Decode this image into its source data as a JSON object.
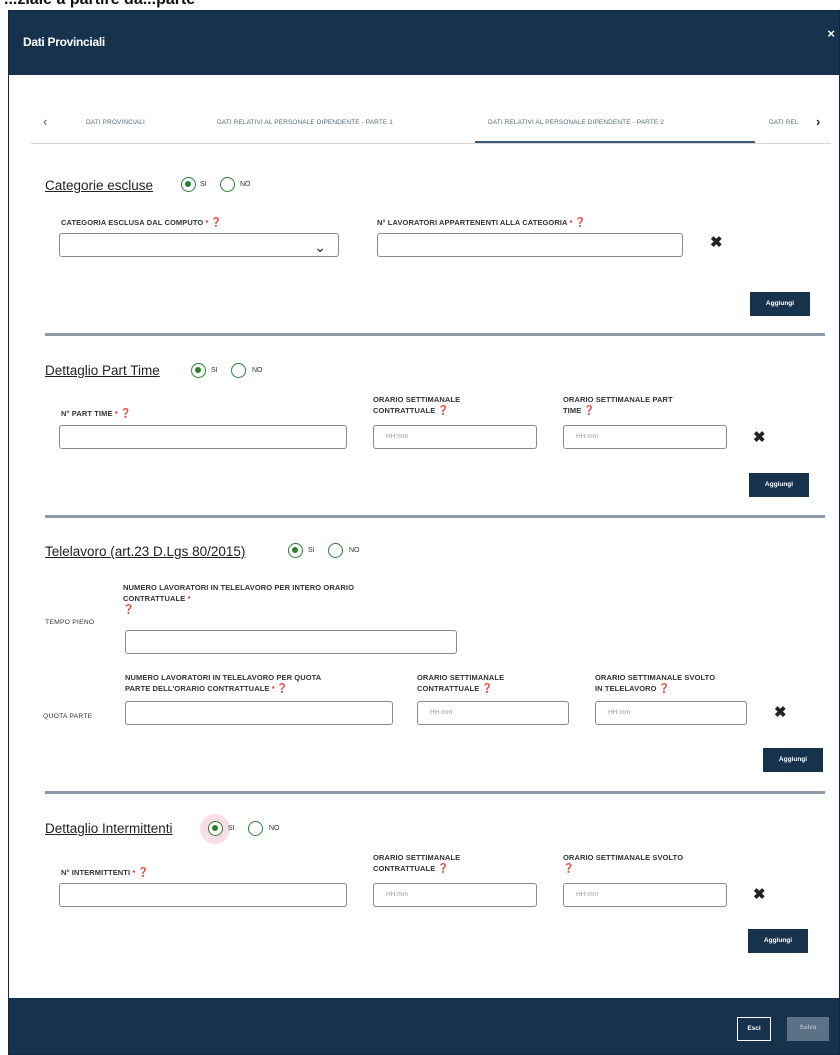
{
  "page_caption": "...ziale a partire da...parte",
  "dialog": {
    "title": "Dati Provinciali",
    "close": "×"
  },
  "tabs": {
    "prev": "‹",
    "next": "›",
    "items": [
      "DATI PROVINCIALI",
      "DATI RELATIVI AL PERSONALE DIPENDENTE - PARTE 1",
      "DATI RELATIVI AL PERSONALE DIPENDENTE - PARTE 2",
      "DATI REL"
    ],
    "active_index": 2
  },
  "radio": {
    "yes": "SI",
    "no": "NO"
  },
  "common": {
    "time_placeholder": "HH:mm",
    "add": "Aggiungi",
    "remove": "✖",
    "req": "*",
    "help": "❓"
  },
  "categorie": {
    "title": "Categorie escluse",
    "selected": "SI",
    "field1": "CATEGORIA ESCLUSA DAL COMPUTO",
    "field2": "N° LAVORATORI APPARTENENTI ALLA CATEGORIA",
    "select_value": ""
  },
  "parttime": {
    "title": "Dettaglio Part Time",
    "selected": "SI",
    "field1": "N° PART TIME",
    "field2a": "ORARIO SETTIMANALE",
    "field2b": "CONTRATTUALE",
    "field3a": "ORARIO SETTIMANALE PART",
    "field3b": "TIME"
  },
  "telelavoro": {
    "title": "Telelavoro (art.23 D.Lgs 80/2015)",
    "selected": "SI",
    "row1_label": "TEMPO PIENO",
    "row1_field_a": "NUMERO LAVORATORI IN TELELAVORO PER INTERO ORARIO",
    "row1_field_b": "CONTRATTUALE",
    "row2_label": "QUOTA PARTE",
    "row2_field_a": "NUMERO LAVORATORI IN TELELAVORO PER QUOTA",
    "row2_field_b": "PARTE DELL'ORARIO CONTRATTUALE",
    "row2_f2a": "ORARIO SETTIMANALE",
    "row2_f2b": "CONTRATTUALE",
    "row2_f3a": "ORARIO SETTIMANALE SVOLTO",
    "row2_f3b": "IN TELELAVORO"
  },
  "intermittenti": {
    "title": "Dettaglio Intermittenti",
    "selected": "SI",
    "field1": "N° INTERMITTENTI",
    "field2a": "ORARIO SETTIMANALE",
    "field2b": "CONTRATTUALE",
    "field3": "ORARIO SETTIMANALE SVOLTO"
  },
  "footer": {
    "exit": "Esci",
    "save": "Salva"
  }
}
